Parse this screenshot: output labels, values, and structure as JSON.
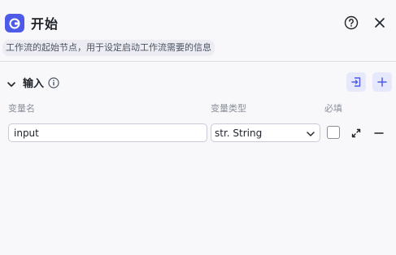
{
  "header": {
    "title": "开始",
    "description": "工作流的起始节点，用于设定启动工作流需要的信息",
    "icon": "start-node-icon",
    "accent_color": "#4e5be8"
  },
  "inputs_section": {
    "title": "输入",
    "columns": {
      "name": "变量名",
      "type": "变量类型",
      "required": "必填"
    },
    "rows": [
      {
        "name": "input",
        "type": "str. String",
        "required": false
      }
    ]
  }
}
